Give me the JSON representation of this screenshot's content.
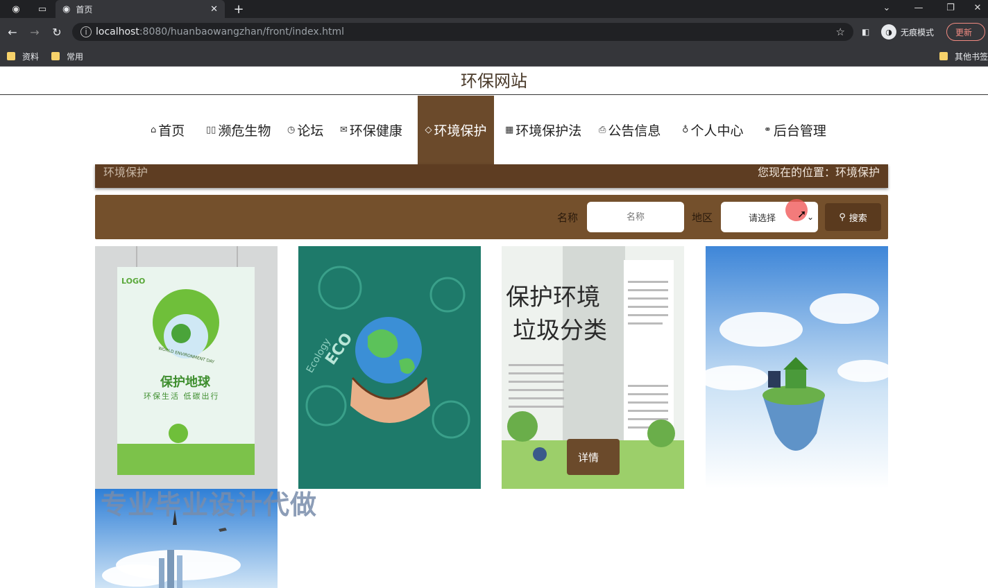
{
  "browser": {
    "tab_title": "首页",
    "url_host": "localhost",
    "url_path": ":8080/huanbaowangzhan/front/index.html",
    "incognito_label": "无痕模式",
    "update_label": "更新",
    "bookmarks": [
      "资料",
      "常用"
    ],
    "other_bookmarks": "其他书签"
  },
  "site": {
    "title": "环保网站"
  },
  "nav": [
    {
      "icon": "⌂",
      "label": "首页"
    },
    {
      "icon": "▯▯",
      "label": "濒危生物"
    },
    {
      "icon": "◷",
      "label": "论坛"
    },
    {
      "icon": "✉",
      "label": "环保健康"
    },
    {
      "icon": "◇",
      "label": "环境保护"
    },
    {
      "icon": "▦",
      "label": "环境保护法"
    },
    {
      "icon": "⎙",
      "label": "公告信息"
    },
    {
      "icon": "♁",
      "label": "个人中心"
    },
    {
      "icon": "⚭",
      "label": "后台管理"
    }
  ],
  "breadcrumb": {
    "section": "环境保护",
    "location": "您现在的位置：环境保护"
  },
  "search": {
    "name_label": "名称",
    "name_placeholder": "名称",
    "area_label": "地区",
    "area_selected": "请选择",
    "button_label": "搜索"
  },
  "cards": {
    "poster1": {
      "logo": "LOGO",
      "title": "保护地球",
      "subtitle": "环保生活 低碳出行",
      "badge": "WORLD ENVIRONMENT DAY"
    },
    "poster2": {
      "words": [
        "ECO",
        "Ecology"
      ]
    },
    "poster3": {
      "title_line1": "保护环境",
      "title_line2": "垃圾分类"
    },
    "hover_tag": "详情"
  },
  "watermark": "专业毕业设计代做",
  "colors": {
    "accent": "#6b4a2b",
    "crumb": "#5e3d22",
    "search_bar": "#74502c"
  }
}
